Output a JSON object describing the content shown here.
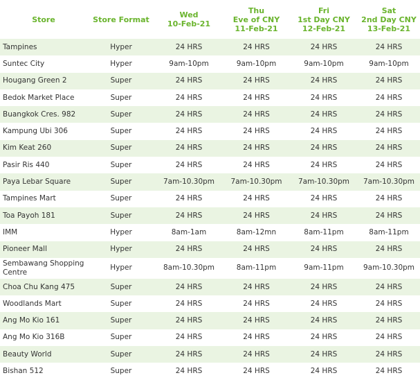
{
  "headers": [
    {
      "lines": [
        "Store"
      ]
    },
    {
      "lines": [
        "Store Format"
      ]
    },
    {
      "lines": [
        "Wed",
        "10-Feb-21"
      ]
    },
    {
      "lines": [
        "Thu",
        "Eve of CNY",
        "11-Feb-21"
      ]
    },
    {
      "lines": [
        "Fri",
        "1st Day CNY",
        "12-Feb-21"
      ]
    },
    {
      "lines": [
        "Sat",
        "2nd Day CNY",
        "13-Feb-21"
      ]
    }
  ],
  "rows": [
    {
      "store": "Tampines",
      "format": "Hyper",
      "wed": "24 HRS",
      "thu": "24 HRS",
      "fri": "24 HRS",
      "sat": "24 HRS"
    },
    {
      "store": "Suntec City",
      "format": "Hyper",
      "wed": "9am-10pm",
      "thu": "9am-10pm",
      "fri": "9am-10pm",
      "sat": "9am-10pm"
    },
    {
      "store": "Hougang Green 2",
      "format": "Super",
      "wed": "24 HRS",
      "thu": "24 HRS",
      "fri": "24 HRS",
      "sat": "24 HRS"
    },
    {
      "store": "Bedok Market Place",
      "format": "Super",
      "wed": "24 HRS",
      "thu": "24 HRS",
      "fri": "24 HRS",
      "sat": "24 HRS"
    },
    {
      "store": "Buangkok Cres. 982",
      "format": "Super",
      "wed": "24 HRS",
      "thu": "24 HRS",
      "fri": "24 HRS",
      "sat": "24 HRS"
    },
    {
      "store": "Kampung Ubi 306",
      "format": "Super",
      "wed": "24 HRS",
      "thu": "24 HRS",
      "fri": "24 HRS",
      "sat": "24 HRS"
    },
    {
      "store": "Kim Keat 260",
      "format": "Super",
      "wed": "24 HRS",
      "thu": "24 HRS",
      "fri": "24 HRS",
      "sat": "24 HRS"
    },
    {
      "store": "Pasir Ris 440",
      "format": "Super",
      "wed": "24 HRS",
      "thu": "24 HRS",
      "fri": "24 HRS",
      "sat": "24 HRS"
    },
    {
      "store": "Paya Lebar Square",
      "format": "Super",
      "wed": "7am-10.30pm",
      "thu": "7am-10.30pm",
      "fri": "7am-10.30pm",
      "sat": "7am-10.30pm"
    },
    {
      "store": "Tampines Mart",
      "format": "Super",
      "wed": "24 HRS",
      "thu": "24 HRS",
      "fri": "24 HRS",
      "sat": "24 HRS"
    },
    {
      "store": "Toa Payoh 181",
      "format": "Super",
      "wed": "24 HRS",
      "thu": "24 HRS",
      "fri": "24 HRS",
      "sat": "24 HRS"
    },
    {
      "store": "IMM",
      "format": "Hyper",
      "wed": "8am-1am",
      "thu": "8am-12mn",
      "fri": "8am-11pm",
      "sat": "8am-11pm"
    },
    {
      "store": "Pioneer Mall",
      "format": "Hyper",
      "wed": "24 HRS",
      "thu": "24 HRS",
      "fri": "24 HRS",
      "sat": "24 HRS"
    },
    {
      "store": "Sembawang Shopping Centre",
      "format": "Hyper",
      "wed": "8am-10.30pm",
      "thu": "8am-11pm",
      "fri": "9am-11pm",
      "sat": "9am-10.30pm"
    },
    {
      "store": "Choa Chu Kang 475",
      "format": "Super",
      "wed": "24 HRS",
      "thu": "24 HRS",
      "fri": "24 HRS",
      "sat": "24 HRS"
    },
    {
      "store": "Woodlands Mart",
      "format": "Super",
      "wed": "24 HRS",
      "thu": "24 HRS",
      "fri": "24 HRS",
      "sat": "24 HRS"
    },
    {
      "store": "Ang Mo Kio 161",
      "format": "Super",
      "wed": "24 HRS",
      "thu": "24 HRS",
      "fri": "24 HRS",
      "sat": "24 HRS"
    },
    {
      "store": "Ang Mo Kio 316B",
      "format": "Super",
      "wed": "24 HRS",
      "thu": "24 HRS",
      "fri": "24 HRS",
      "sat": "24 HRS"
    },
    {
      "store": "Beauty World",
      "format": "Super",
      "wed": "24 HRS",
      "thu": "24 HRS",
      "fri": "24 HRS",
      "sat": "24 HRS"
    },
    {
      "store": "Bishan 512",
      "format": "Super",
      "wed": "24 HRS",
      "thu": "24 HRS",
      "fri": "24 HRS",
      "sat": "24 HRS"
    }
  ],
  "colors": {
    "header_text": "#6ab42d",
    "stripe": "#eaf4e2",
    "body_text": "#333333"
  }
}
